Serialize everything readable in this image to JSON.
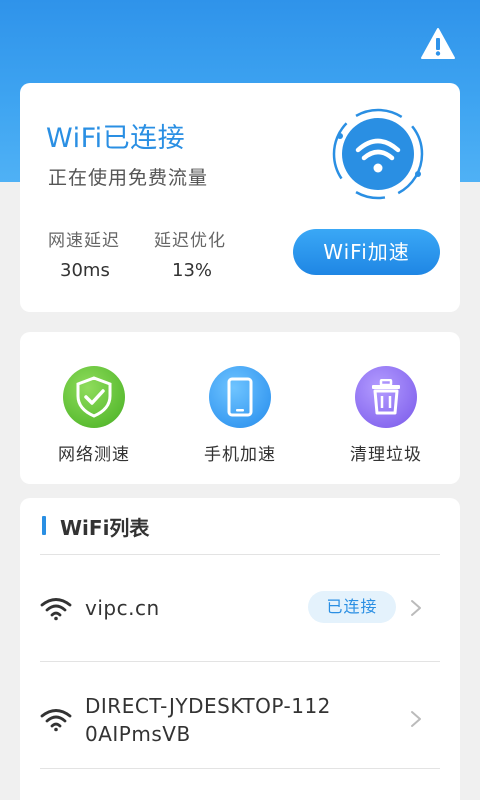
{
  "status": {
    "title": "WiFi已连接",
    "subtitle": "正在使用免费流量",
    "metrics": [
      {
        "label": "网速延迟",
        "value": "30ms"
      },
      {
        "label": "延迟优化",
        "value": "13%"
      }
    ],
    "boost_label": "WiFi加速"
  },
  "header": {
    "warning_icon": "warning-icon"
  },
  "tools": [
    {
      "label": "网络测速",
      "icon": "shield-check-icon"
    },
    {
      "label": "手机加速",
      "icon": "phone-icon"
    },
    {
      "label": "清理垃圾",
      "icon": "trash-icon"
    }
  ],
  "wifi_list": {
    "title": "WiFi列表",
    "items": [
      {
        "name": "vipc.cn",
        "badge": "已连接"
      },
      {
        "name": "DIRECT-JYDESKTOP-1120AIPmsVB",
        "badge": ""
      }
    ]
  },
  "colors": {
    "accent": "#2a8fe3",
    "header": "#3ea4f1",
    "green": "#5cbd33",
    "purple": "#8a6cf0"
  }
}
